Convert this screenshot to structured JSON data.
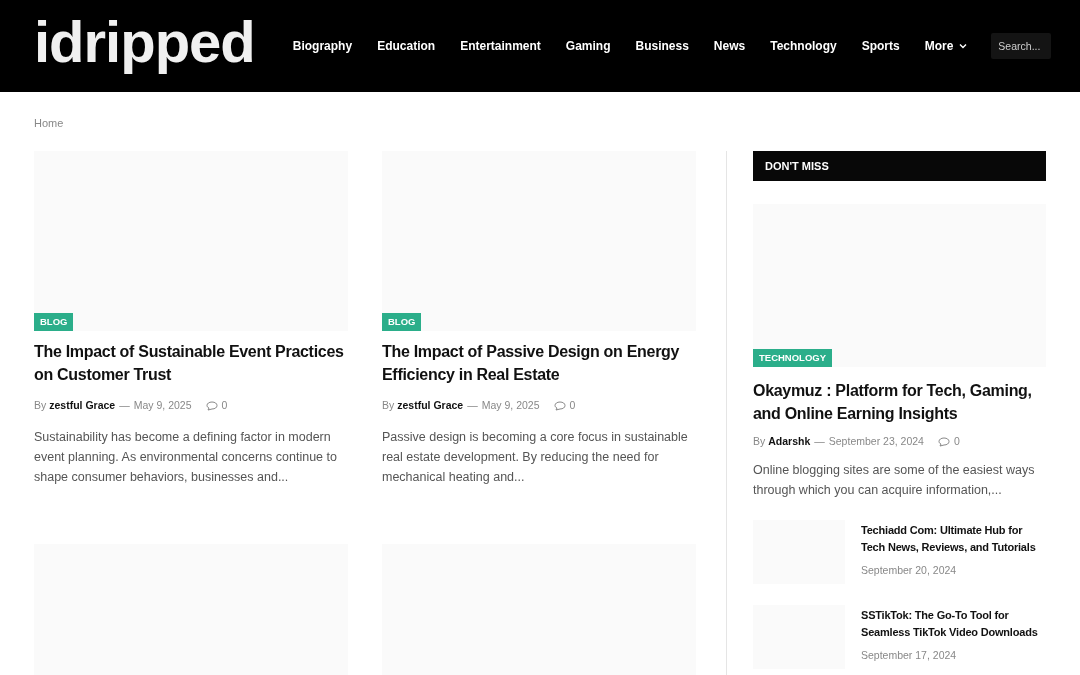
{
  "site": {
    "logo": "idripped"
  },
  "nav": [
    {
      "label": "Biography"
    },
    {
      "label": "Education"
    },
    {
      "label": "Entertainment"
    },
    {
      "label": "Gaming"
    },
    {
      "label": "Business"
    },
    {
      "label": "News"
    },
    {
      "label": "Technology"
    },
    {
      "label": "Sports"
    },
    {
      "label": "More",
      "dropdown": true
    }
  ],
  "search": {
    "placeholder": "Search..."
  },
  "breadcrumb": [
    "Home"
  ],
  "articles": [
    {
      "kind": "post",
      "category": "BLOG",
      "title": "The Impact of Sustainable Event Practices on Customer Trust",
      "by": "By",
      "author": "zestful Grace",
      "separator": "—",
      "date": "May 9, 2025",
      "comments": "0",
      "excerpt": "Sustainability has become a defining factor in modern event planning. As environmental concerns continue to shape consumer behaviors, businesses and..."
    },
    {
      "kind": "post",
      "category": "BLOG",
      "title": "The Impact of Passive Design on Energy Efficiency in Real Estate",
      "by": "By",
      "author": "zestful Grace",
      "separator": "—",
      "date": "May 9, 2025",
      "comments": "0",
      "excerpt": "Passive design is becoming a core focus in sustainable real estate development. By reducing the need for mechanical heating and..."
    },
    {
      "kind": "image-only"
    },
    {
      "kind": "image-only"
    }
  ],
  "sidebar": {
    "heading": "DON'T MISS",
    "featured": {
      "category": "TECHNOLOGY",
      "title": "Okaymuz : Platform for Tech, Gaming, and Online Earning Insights",
      "by": "By",
      "author": "Adarshk",
      "separator": "—",
      "date": "September 23, 2024",
      "comments": "0",
      "excerpt": "Online blogging sites are some of the easiest ways through which you can acquire information,..."
    },
    "items": [
      {
        "title": "Techiadd Com: Ultimate Hub for Tech News, Reviews, and Tutorials",
        "date": "September 20, 2024"
      },
      {
        "title": "SSTikTok: The Go-To Tool for Seamless TikTok Video Downloads",
        "date": "September 17, 2024"
      }
    ]
  }
}
